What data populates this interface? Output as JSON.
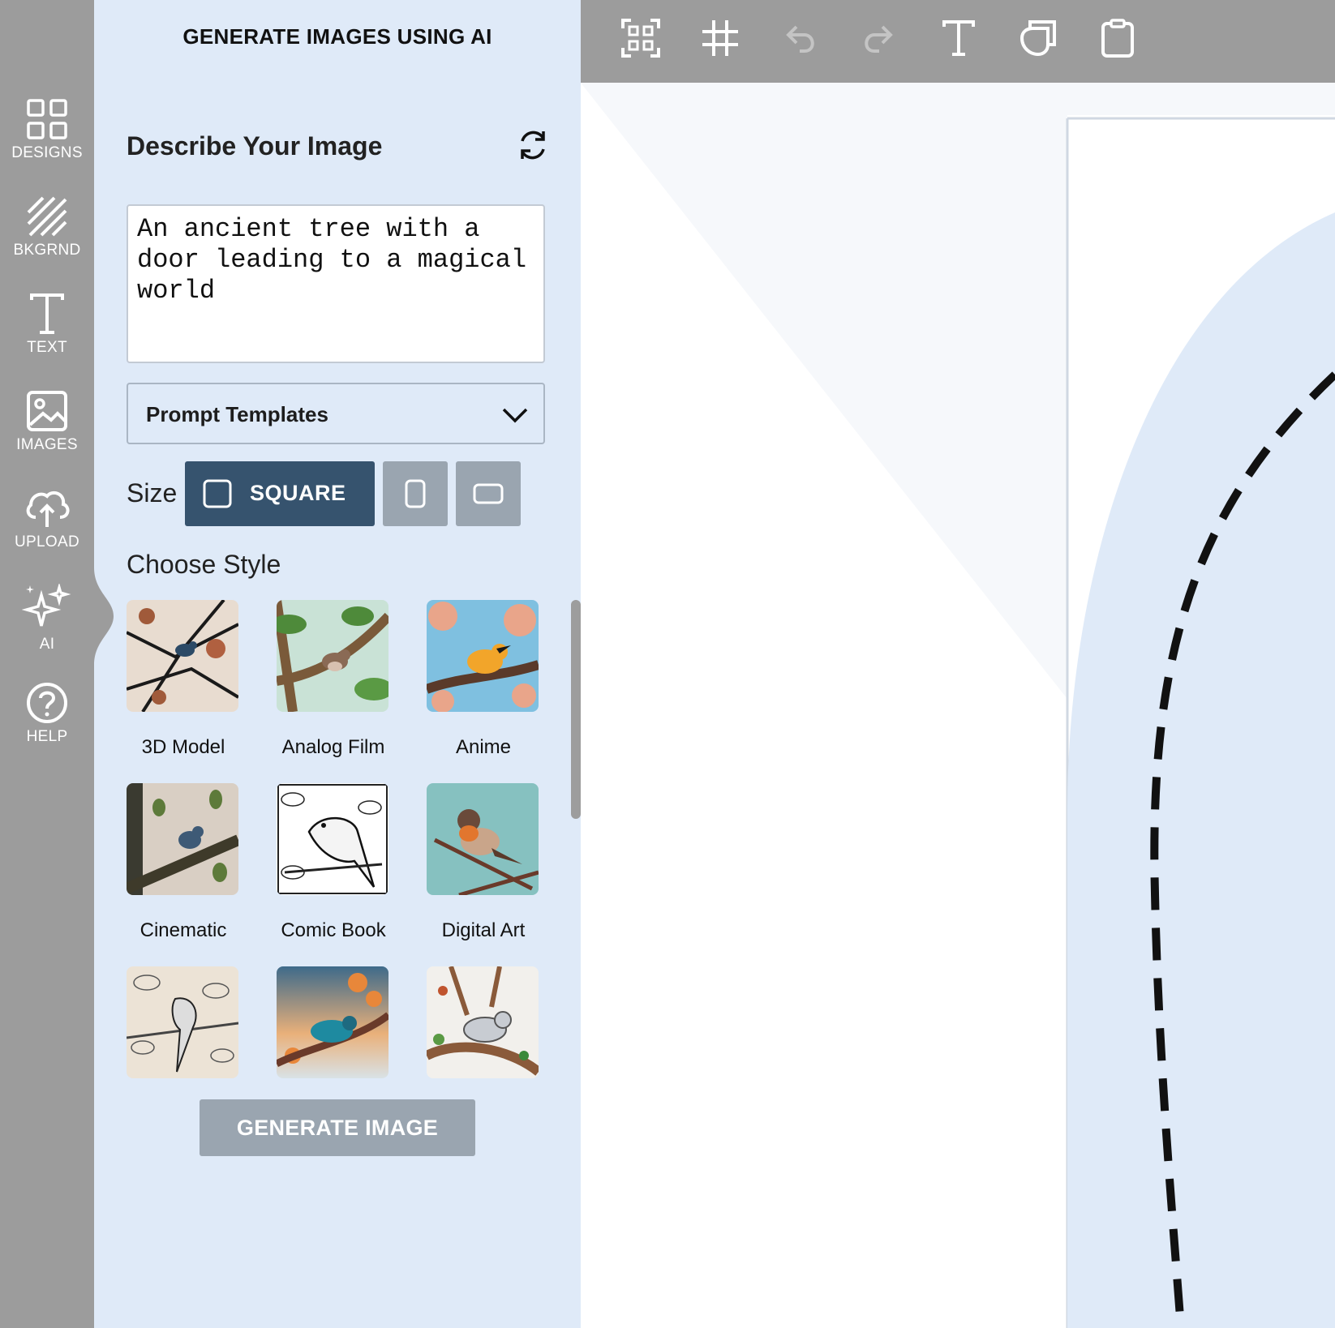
{
  "rail": {
    "items": [
      {
        "label": "DESIGNS",
        "icon": "grid-icon"
      },
      {
        "label": "BKGRND",
        "icon": "diagonal-stripes-icon"
      },
      {
        "label": "TEXT",
        "icon": "text-icon"
      },
      {
        "label": "IMAGES",
        "icon": "image-icon"
      },
      {
        "label": "UPLOAD",
        "icon": "cloud-upload-icon"
      },
      {
        "label": "AI",
        "icon": "sparkles-icon",
        "active": true
      },
      {
        "label": "HELP",
        "icon": "help-circle-icon"
      }
    ]
  },
  "panel": {
    "title": "GENERATE IMAGES USING AI",
    "describe_label": "Describe Your Image",
    "prompt_value": "An ancient tree with a door leading to a magical world",
    "templates_label": "Prompt Templates",
    "size_label": "Size",
    "size_selected": "SQUARE",
    "choose_style": "Choose Style",
    "styles": [
      {
        "label": "3D Model"
      },
      {
        "label": "Analog Film"
      },
      {
        "label": "Anime"
      },
      {
        "label": "Cinematic"
      },
      {
        "label": "Comic Book"
      },
      {
        "label": "Digital Art"
      },
      {
        "label": ""
      },
      {
        "label": ""
      },
      {
        "label": ""
      }
    ],
    "generate_label": "GENERATE IMAGE"
  },
  "toolbar": {
    "tools": [
      "qr-code-icon",
      "grid-hash-icon",
      "undo-icon",
      "redo-icon",
      "text-icon",
      "layers-icon",
      "clipboard-icon"
    ]
  },
  "colors": {
    "rail": "#9c9c9c",
    "panel": "#dfeaf8",
    "accent": "#36536e",
    "disabled": "#9aa5b0"
  }
}
